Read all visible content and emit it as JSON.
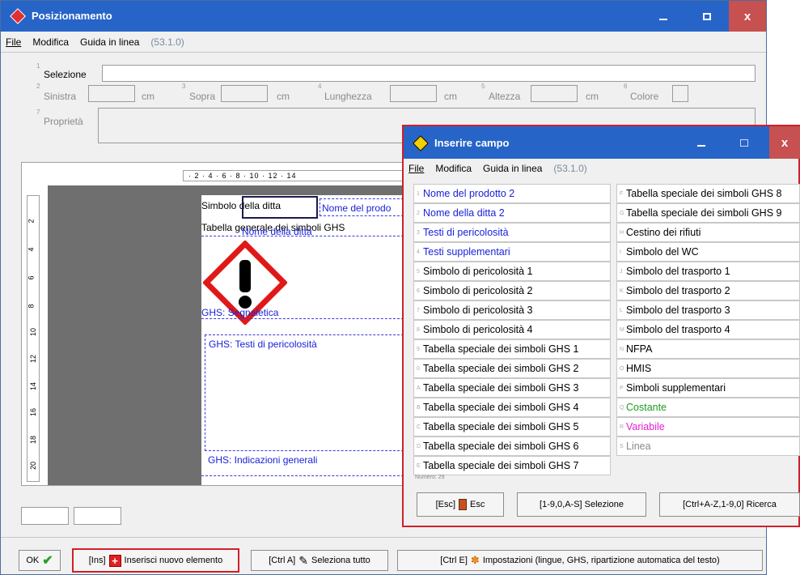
{
  "main": {
    "title": "Posizionamento",
    "menu": {
      "file": "File",
      "edit": "Modifica",
      "help": "Guida in linea",
      "version": "(53.1.0)"
    },
    "form": {
      "selection_label": "Selezione",
      "left_label": "Sinistra",
      "top_label": "Sopra",
      "length_label": "Lunghezza",
      "height_label": "Altezza",
      "color_label": "Colore",
      "unit": "cm",
      "properties_label": "Proprietà",
      "nums": {
        "n1": "1",
        "n2": "2",
        "n3": "3",
        "n4": "4",
        "n5": "5",
        "n6": "6",
        "n7": "7"
      }
    },
    "ruler_top": "· 2 · 4 · 6 · 8 · 10 · 12 · 14",
    "ruler_left": [
      "2",
      "4",
      "6",
      "8",
      "10",
      "12",
      "14",
      "16",
      "18",
      "20"
    ],
    "label_items": {
      "company_symbol": "Simbolo della ditta",
      "product_name": "Nome del prodo",
      "ghs_table": "Tabella generale dei simboli GHS",
      "company_name": "Nome della ditta",
      "signal_word": "GHS: Segnaletica",
      "hazard_texts": "GHS: Testi di pericolosità",
      "general_info": "GHS: Indicazioni generali"
    },
    "bottom": {
      "ok": "OK",
      "insert": "[Ins]",
      "insert_label": "Inserisci nuovo elemento",
      "select_all_key": "[Ctrl A]",
      "select_all_label": "Seleziona tutto",
      "settings_key": "[Ctrl E]",
      "settings_label": "Impostazioni (lingue, GHS, ripartizione automatica del testo)"
    }
  },
  "dialog": {
    "title": "Inserire campo",
    "menu": {
      "file": "File",
      "edit": "Modifica",
      "help": "Guida in linea",
      "version": "(53.1.0)"
    },
    "left_col": [
      {
        "key": "1",
        "label": "Nome del prodotto 2",
        "color": "blue"
      },
      {
        "key": "2",
        "label": "Nome della ditta 2",
        "color": "blue"
      },
      {
        "key": "3",
        "label": "Testi di pericolosità",
        "color": "blue"
      },
      {
        "key": "4",
        "label": "Testi supplementari",
        "color": "blue"
      },
      {
        "key": "5",
        "label": "Simbolo di pericolosità 1",
        "color": "black"
      },
      {
        "key": "6",
        "label": "Simbolo di pericolosità 2",
        "color": "black"
      },
      {
        "key": "7",
        "label": "Simbolo di pericolosità 3",
        "color": "black"
      },
      {
        "key": "8",
        "label": "Simbolo di pericolosità 4",
        "color": "black"
      },
      {
        "key": "9",
        "label": "Tabella speciale dei simboli GHS 1",
        "color": "black"
      },
      {
        "key": "0",
        "label": "Tabella speciale dei simboli GHS 2",
        "color": "black"
      },
      {
        "key": "A",
        "label": "Tabella speciale dei simboli GHS 3",
        "color": "black"
      },
      {
        "key": "B",
        "label": "Tabella speciale dei simboli GHS 4",
        "color": "black"
      },
      {
        "key": "C",
        "label": "Tabella speciale dei simboli GHS 5",
        "color": "black"
      },
      {
        "key": "D",
        "label": "Tabella speciale dei simboli GHS 6",
        "color": "black"
      },
      {
        "key": "E",
        "label": "Tabella speciale dei simboli GHS 7",
        "color": "black"
      }
    ],
    "right_col": [
      {
        "key": "F",
        "label": "Tabella speciale dei simboli GHS 8",
        "color": "black"
      },
      {
        "key": "G",
        "label": "Tabella speciale dei simboli GHS 9",
        "color": "black"
      },
      {
        "key": "H",
        "label": "Cestino dei rifiuti",
        "color": "black"
      },
      {
        "key": "I",
        "label": "Simbolo del WC",
        "color": "black"
      },
      {
        "key": "J",
        "label": "Simbolo del trasporto 1",
        "color": "black"
      },
      {
        "key": "K",
        "label": "Simbolo del trasporto 2",
        "color": "black"
      },
      {
        "key": "L",
        "label": "Simbolo del trasporto 3",
        "color": "black"
      },
      {
        "key": "M",
        "label": "Simbolo del trasporto 4",
        "color": "black"
      },
      {
        "key": "N",
        "label": "NFPA",
        "color": "black"
      },
      {
        "key": "O",
        "label": "HMIS",
        "color": "black"
      },
      {
        "key": "P",
        "label": "Simboli supplementari",
        "color": "black"
      },
      {
        "key": "Q",
        "label": "Costante",
        "color": "green"
      },
      {
        "key": "R",
        "label": "Variabile",
        "color": "magenta"
      },
      {
        "key": "S",
        "label": "Linea",
        "color": "gray"
      }
    ],
    "numbers": "Numero: 29",
    "buttons": {
      "esc_key": "[Esc]",
      "esc_label": "Esc",
      "select": "[1-9,0,A-S] Selezione",
      "search": "[Ctrl+A-Z,1-9,0] Ricerca"
    }
  }
}
